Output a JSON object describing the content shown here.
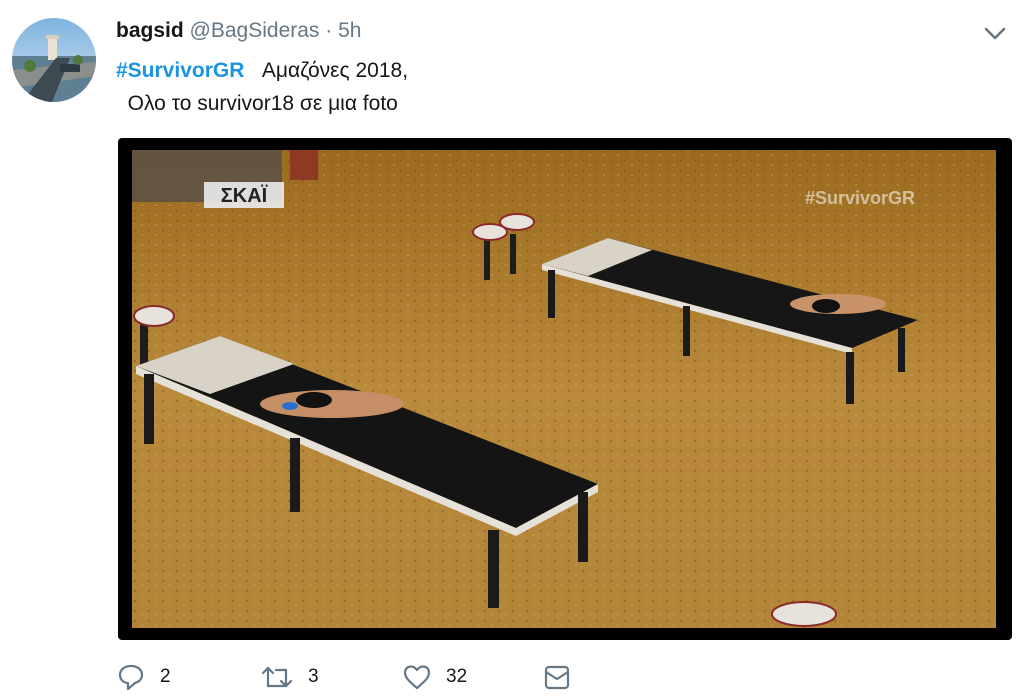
{
  "tweet": {
    "display_name": "bagsid",
    "handle": "@BagSideras",
    "separator": "·",
    "time": "5h",
    "hashtag": "#SurvivorGR",
    "text_line1": "   Αμαζόνες 2018,",
    "text_line2": "  Ολο το survivor18 σε μια foto",
    "media": {
      "channel_logo": "ΣΚΑΪ",
      "watermark": "#SurvivorGR"
    },
    "actions": {
      "reply_count": "2",
      "retweet_count": "3",
      "like_count": "32"
    }
  },
  "icons": [
    "caret-down-icon",
    "reply-icon",
    "retweet-icon",
    "like-icon",
    "direct-message-icon"
  ],
  "colors": {
    "link": "#1b95e0",
    "muted": "#657786",
    "text": "#14171a"
  }
}
